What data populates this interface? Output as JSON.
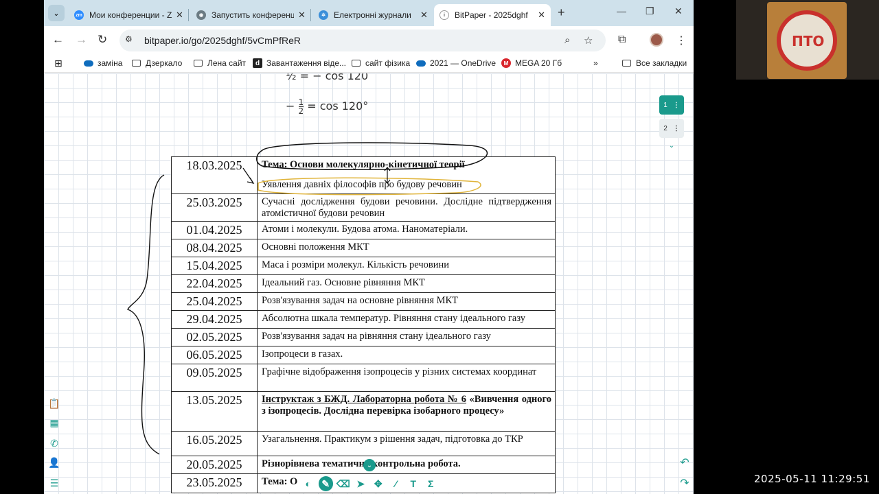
{
  "tabs": [
    {
      "title": "Мои конференции - Z",
      "favicon": "zoom-icon"
    },
    {
      "title": "Запустить конференц",
      "favicon": "globe-icon"
    },
    {
      "title": "Електронні журнали",
      "favicon": "journal-icon"
    },
    {
      "title": "BitPaper - 2025dghf",
      "favicon": "bitpaper-icon",
      "active": true
    }
  ],
  "address": {
    "url": "bitpaper.io/go/2025dghf/5vCmPfReR"
  },
  "bookmarks": [
    {
      "label": "заміна",
      "icon": "onedrive-icon"
    },
    {
      "label": "Дзеркало",
      "icon": "folder-icon"
    },
    {
      "label": "Лена сайт",
      "icon": "folder-icon"
    },
    {
      "label": "Завантаження віде...",
      "icon": "d-icon"
    },
    {
      "label": "сайт фізика",
      "icon": "folder-icon"
    },
    {
      "label": "2021 — OneDrive",
      "icon": "onedrive-icon"
    },
    {
      "label": "MEGA 20 Гб",
      "icon": "mega-icon"
    }
  ],
  "bookmarks_all": "Все закладки",
  "math": {
    "line1": "½ = − cos 120",
    "line2_minus": "−",
    "line2_num": "1",
    "line2_den": "2",
    "line2_rest": "= cos 120°"
  },
  "pages": [
    "1",
    "2"
  ],
  "schedule": [
    {
      "date": "18.03.2025",
      "topic": "Тема: Основи молекулярно-кінетичної теорії",
      "topic2": "Уявлення давніх філософів про будову речовин",
      "bold": "first"
    },
    {
      "date": "25.03.2025",
      "topic": "Сучасні дослідження будови речовини. Дослідне підтвердження атомістичної будови речовин"
    },
    {
      "date": "01.04.2025",
      "topic": "Атоми і молекули. Будова атома. Наноматеріали."
    },
    {
      "date": "08.04.2025",
      "topic": "Основні положення МКТ"
    },
    {
      "date": "15.04.2025",
      "topic": "Маса і розміри молекул. Кількість речовини"
    },
    {
      "date": "22.04.2025",
      "topic": "Ідеальний газ. Основне рівняння МКТ"
    },
    {
      "date": "25.04.2025",
      "topic": "Розв'язування задач на основне рівняння МКТ"
    },
    {
      "date": "29.04.2025",
      "topic": "Абсолютна шкала температур. Рівняння стану ідеального газу"
    },
    {
      "date": "02.05.2025",
      "topic": "Розв'язування задач на рівняння стану ідеального газу"
    },
    {
      "date": "06.05.2025",
      "topic": "Ізопроцеси в газах."
    },
    {
      "date": "09.05.2025",
      "topic": "Графічне відображення ізопроцесів у різних системах координат"
    },
    {
      "date": "13.05.2025",
      "topic_ul": "Інструктаж з БЖД. Лабораторна робота № 6",
      "topic": " «Вивчення одного з ізопроцесів. Дослідна перевірка ізобарного процесу»",
      "bold": "all"
    },
    {
      "date": "16.05.2025",
      "topic": "Узагальнення. Практикум з рішення задач,  підготовка до ТКР"
    },
    {
      "date": "20.05.2025",
      "topic": "Різнорівнева тематична контрольна робота.",
      "bold": "all"
    },
    {
      "date": "23.05.2025",
      "topic": "Тема: О",
      "bold": "all"
    }
  ],
  "webcam": {
    "logo_text": "ПТО"
  },
  "clock": "2025-05-11  11:29:51",
  "colors": {
    "accent": "#1a9a8c",
    "tabstrip": "#cfe1eb",
    "highlight": "#e0b43a"
  }
}
